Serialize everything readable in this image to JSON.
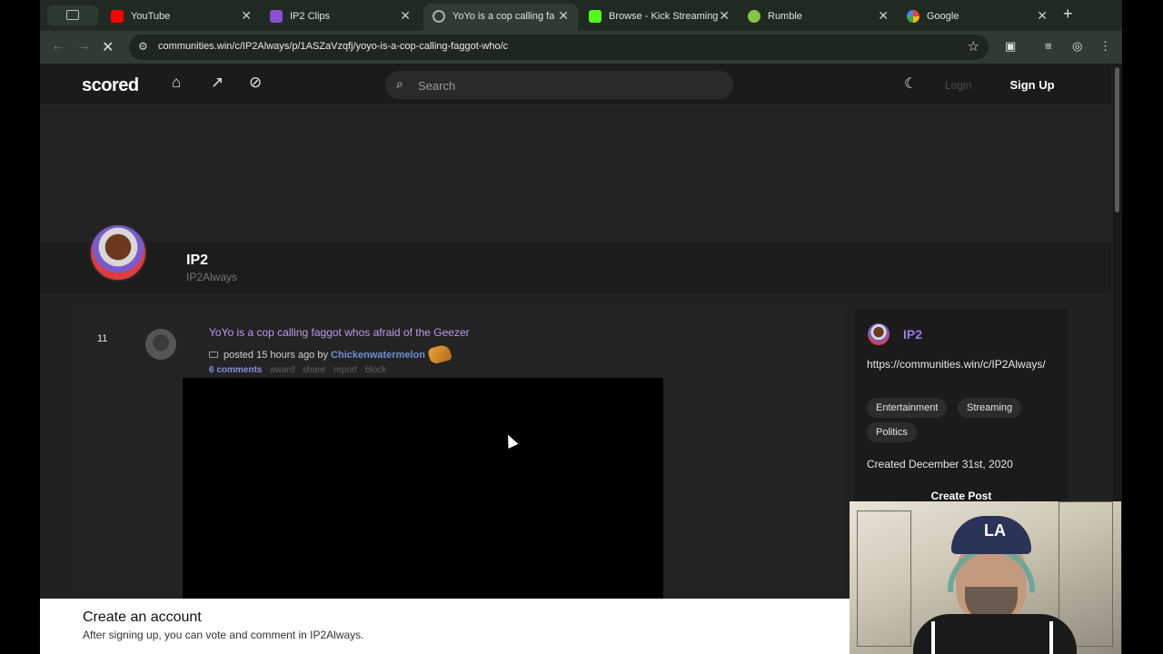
{
  "browser": {
    "tabs": [
      {
        "title": "YouTube",
        "icon": "youtube-icon",
        "color": "#ff0000"
      },
      {
        "title": "IP2 Clips",
        "icon": "ip2-icon",
        "color": "#8a4fd0"
      },
      {
        "title": "YoYo is a cop calling fagg",
        "icon": "loading-icon",
        "color": "#aab3ad"
      },
      {
        "title": "Browse - Kick Streaming",
        "icon": "kick-icon",
        "color": "#53fc18"
      },
      {
        "title": "Rumble",
        "icon": "rumble-icon",
        "color": "#85c742"
      },
      {
        "title": "Google",
        "icon": "google-icon",
        "color": "#4285f4"
      }
    ],
    "new_tab": "+",
    "url": "communities.win/c/IP2Always/p/1ASZaVzqfj/yoyo-is-a-cop-calling-faggot-who/c"
  },
  "site": {
    "logo": "scored",
    "search_placeholder": "Search",
    "login": "Login",
    "signup": "Sign Up"
  },
  "community": {
    "name": "IP2",
    "slug": "IP2Always"
  },
  "post": {
    "score": "11",
    "title": "YoYo is a cop calling faggot whos afraid of the Geezer",
    "posted": "posted 15 hours ago by",
    "author": "Chickenwatermelon",
    "actions": {
      "comments": "6 comments",
      "award": "award",
      "share": "share",
      "report": "report",
      "block": "block"
    }
  },
  "sidebar": {
    "name": "IP2",
    "url": "https://communities.win/c/IP2Always/",
    "tags": [
      "Entertainment",
      "Streaming",
      "Politics"
    ],
    "created": "Created December 31st, 2020",
    "create_post": "Create Post"
  },
  "signup_bar": {
    "heading": "Create an account",
    "text": "After signing up, you can vote and comment in IP2Always."
  },
  "webcam": {
    "cap_logo": "LA"
  }
}
